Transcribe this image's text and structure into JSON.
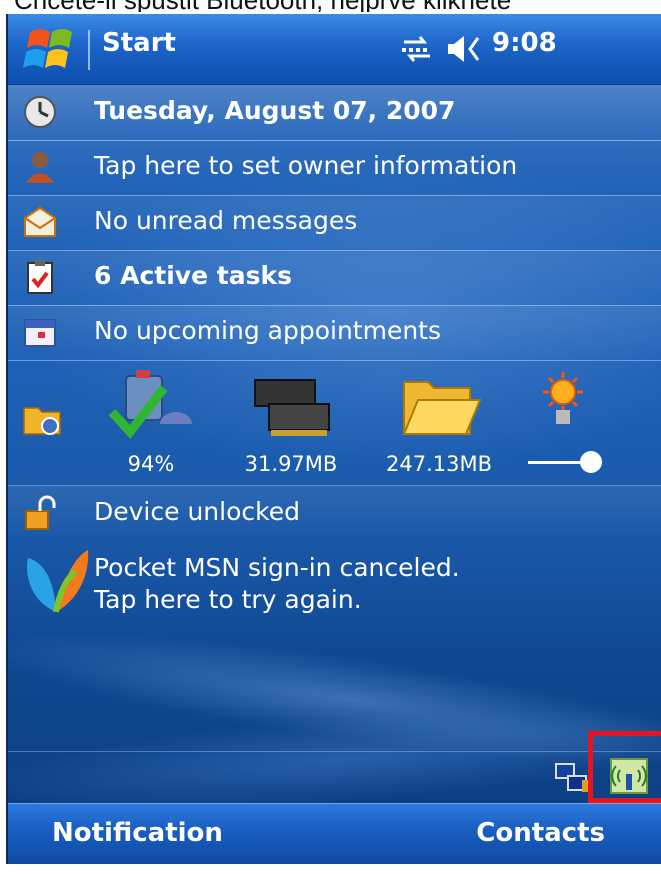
{
  "caption": "Chcete-li spustit Bluetooth, nejprve klikněte",
  "titlebar": {
    "title": "Start",
    "time": "9:08",
    "icons": [
      "windows-start-flag",
      "connectivity-arrows",
      "speaker-volume"
    ]
  },
  "today": {
    "items": [
      {
        "icon": "clock-icon",
        "label": "Tuesday, August 07, 2007",
        "bold": true
      },
      {
        "icon": "owner-icon",
        "label": "Tap here to set owner information",
        "bold": false
      },
      {
        "icon": "envelope-icon",
        "label": "No unread messages",
        "bold": false
      },
      {
        "icon": "tasks-icon",
        "label": "6 Active tasks",
        "bold": true
      },
      {
        "icon": "calendar-icon",
        "label": "No upcoming appointments",
        "bold": false
      }
    ]
  },
  "status": {
    "battery": "94%",
    "memory": "31.97MB",
    "storage": "247.13MB",
    "brightness_level": 0.9
  },
  "lock": {
    "label": "Device unlocked"
  },
  "msn": {
    "line1": "Pocket MSN sign-in canceled.",
    "line2": "Tap here to try again."
  },
  "softkeys": {
    "left": "Notification",
    "right": "Contacts"
  },
  "colors": {
    "highlight": "#e8141b",
    "accent": "#1c5fb6"
  }
}
